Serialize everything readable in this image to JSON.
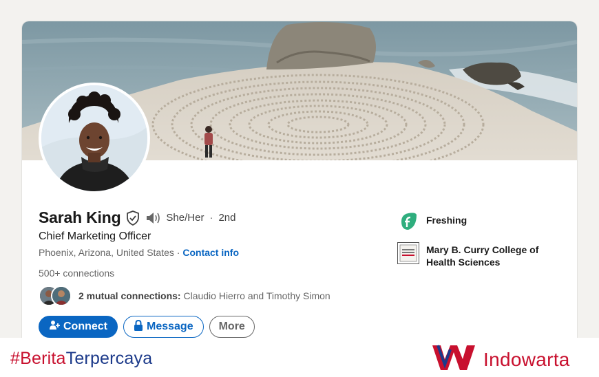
{
  "profile": {
    "name": "Sarah King",
    "pronouns": "She/Her",
    "separator": "·",
    "degree": "2nd",
    "headline": "Chief Marketing Officer",
    "location": "Phoenix, Arizona, United States",
    "location_separator": "·",
    "contact_info": "Contact info",
    "connections": "500+ connections",
    "mutual_prefix": "2 mutual connections:",
    "mutual_names": "Claudio Hierro and Timothy Simon"
  },
  "actions": {
    "connect": "Connect",
    "message": "Message",
    "more": "More"
  },
  "organizations": [
    {
      "name": "Freshing",
      "icon": "freshing-logo-icon"
    },
    {
      "name_line1": "Mary B. Curry College of",
      "name_line2": "Health Sciences",
      "icon": "college-logo-icon"
    }
  ],
  "footer": {
    "hashtag_part1": "#Berita",
    "hashtag_part2": "Terpercaya",
    "brand_name": "Indowarta"
  },
  "colors": {
    "accent": "#0a66c2",
    "brand_red": "#c8102e",
    "brand_blue": "#1c3a8a",
    "freshing_green": "#2fae7e"
  }
}
